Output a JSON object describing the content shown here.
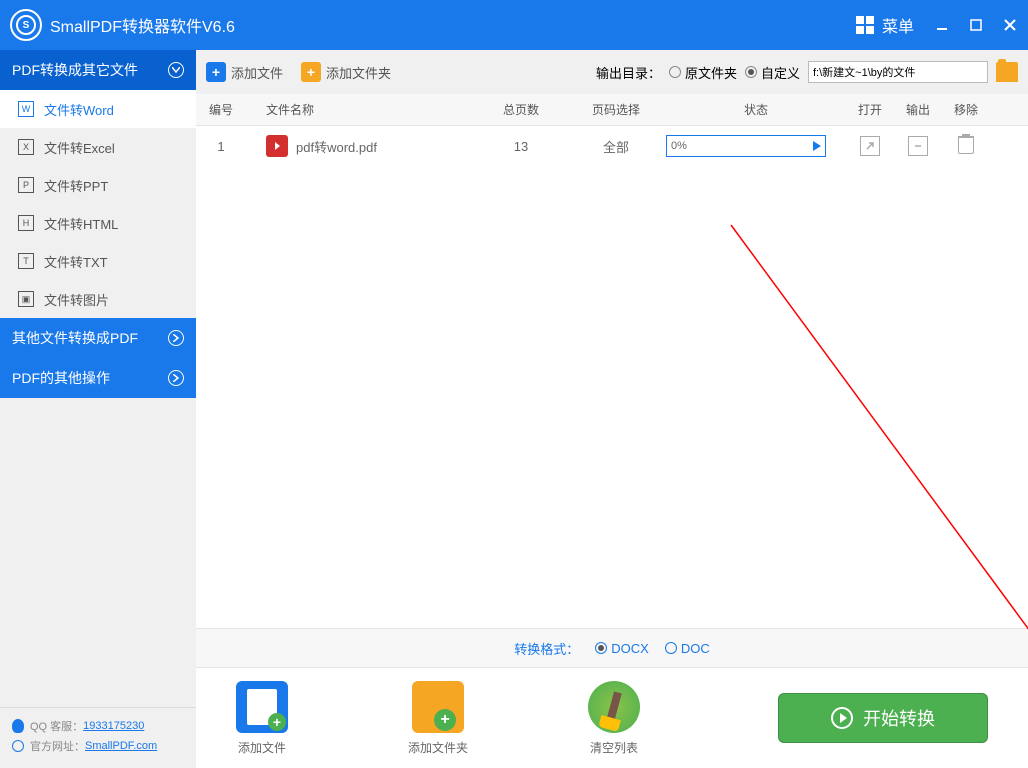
{
  "titlebar": {
    "title": "SmallPDF转换器软件V6.6",
    "menu": "菜单"
  },
  "sidebar": {
    "cat1": {
      "label": "PDF转换成其它文件"
    },
    "items": [
      {
        "icon": "W",
        "label": "文件转Word"
      },
      {
        "icon": "X",
        "label": "文件转Excel"
      },
      {
        "icon": "P",
        "label": "文件转PPT"
      },
      {
        "icon": "H",
        "label": "文件转HTML"
      },
      {
        "icon": "T",
        "label": "文件转TXT"
      },
      {
        "icon": "▣",
        "label": "文件转图片"
      }
    ],
    "cat2": {
      "label": "其他文件转换成PDF"
    },
    "cat3": {
      "label": "PDF的其他操作"
    }
  },
  "toolbar": {
    "add_file": "添加文件",
    "add_folder": "添加文件夹",
    "output_label": "输出目录：",
    "radio_original": "原文件夹",
    "radio_custom": "自定义",
    "path": "f:\\新建文~1\\by的文件"
  },
  "table": {
    "headers": {
      "num": "编号",
      "name": "文件名称",
      "pages": "总页数",
      "select": "页码选择",
      "status": "状态",
      "open": "打开",
      "output": "输出",
      "remove": "移除"
    },
    "rows": [
      {
        "num": "1",
        "name": "pdf转word.pdf",
        "pages": "13",
        "select": "全部",
        "progress": "0%"
      }
    ]
  },
  "format": {
    "label": "转换格式：",
    "opt1": "DOCX",
    "opt2": "DOC"
  },
  "bottom": {
    "add_file": "添加文件",
    "add_folder": "添加文件夹",
    "clear": "清空列表",
    "start": "开始转换"
  },
  "footer": {
    "qq_label": "QQ 客服：",
    "qq": "1933175230",
    "site_label": "官方网址：",
    "site": "SmallPDF.com"
  }
}
